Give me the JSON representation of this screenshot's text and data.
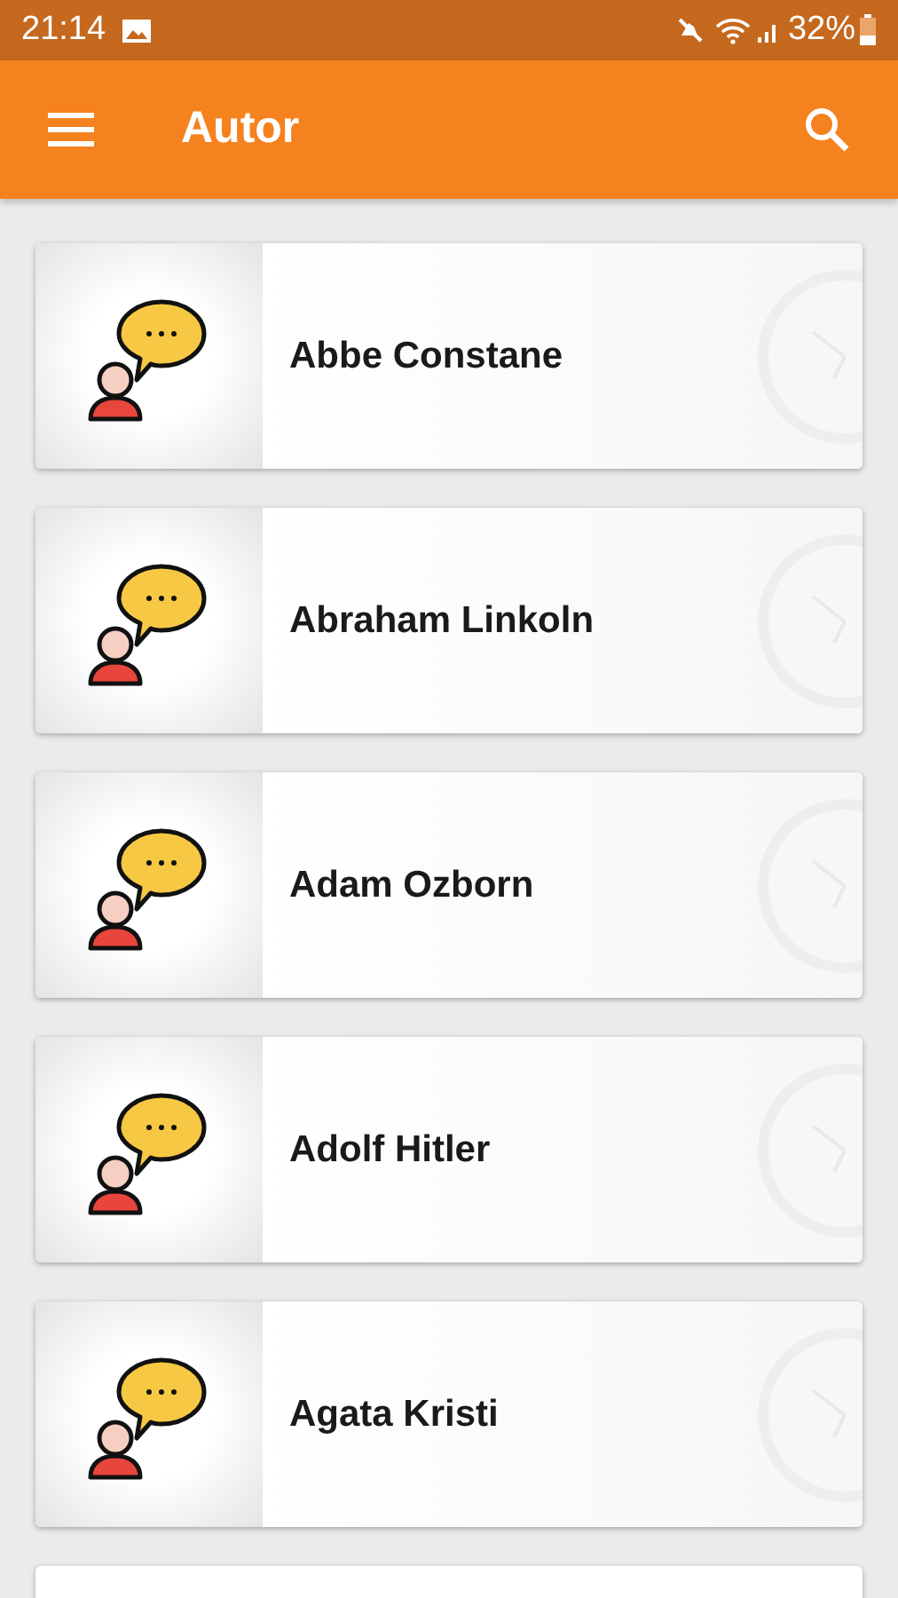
{
  "status_bar": {
    "time": "21:14",
    "battery": "32%"
  },
  "toolbar": {
    "title": "Autor"
  },
  "authors": [
    {
      "name": "Abbe Constane"
    },
    {
      "name": "Abraham Linkoln"
    },
    {
      "name": "Adam Ozborn"
    },
    {
      "name": "Adolf Hitler"
    },
    {
      "name": "Agata Kristi"
    }
  ]
}
